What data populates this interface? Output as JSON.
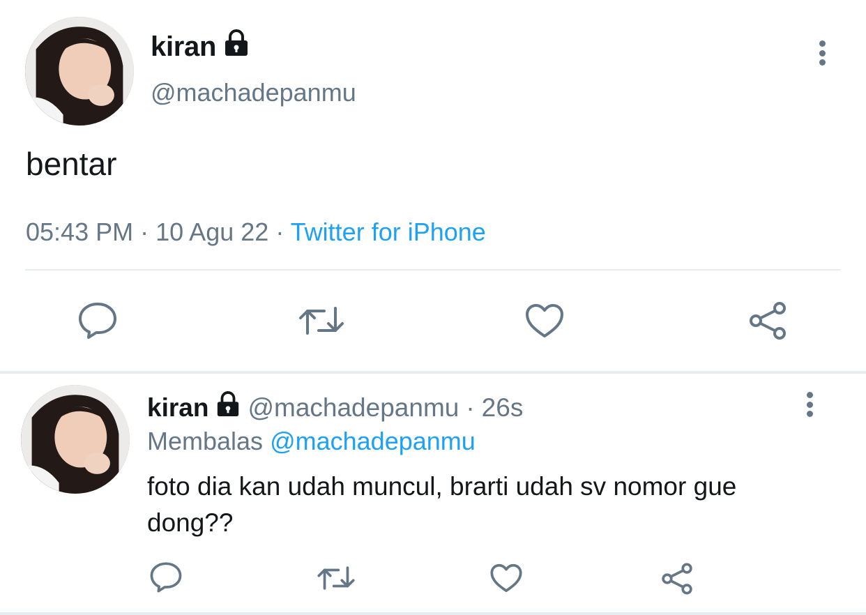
{
  "main_tweet": {
    "author_name": "kiran",
    "author_handle": "@machadepanmu",
    "text": "bentar",
    "time": "05:43 PM",
    "separator": "·",
    "date": "10 Agu 22",
    "source": "Twitter for iPhone"
  },
  "reply_tweet": {
    "author_name": "kiran",
    "author_handle": "@machadepanmu",
    "separator": "·",
    "age": "26s",
    "replying_label": "Membalas",
    "replying_to": "@machadepanmu",
    "text": "foto dia kan udah muncul, brarti udah sv nomor gue dong??"
  },
  "colors": {
    "text": "#14171a",
    "secondary": "#657786",
    "link": "#1da1f2",
    "divider": "#e6ecf0"
  },
  "icons": {
    "lock": "lock-icon",
    "more": "more-vertical-icon",
    "reply": "reply-icon",
    "retweet": "retweet-icon",
    "like": "heart-icon",
    "share": "share-icon"
  }
}
